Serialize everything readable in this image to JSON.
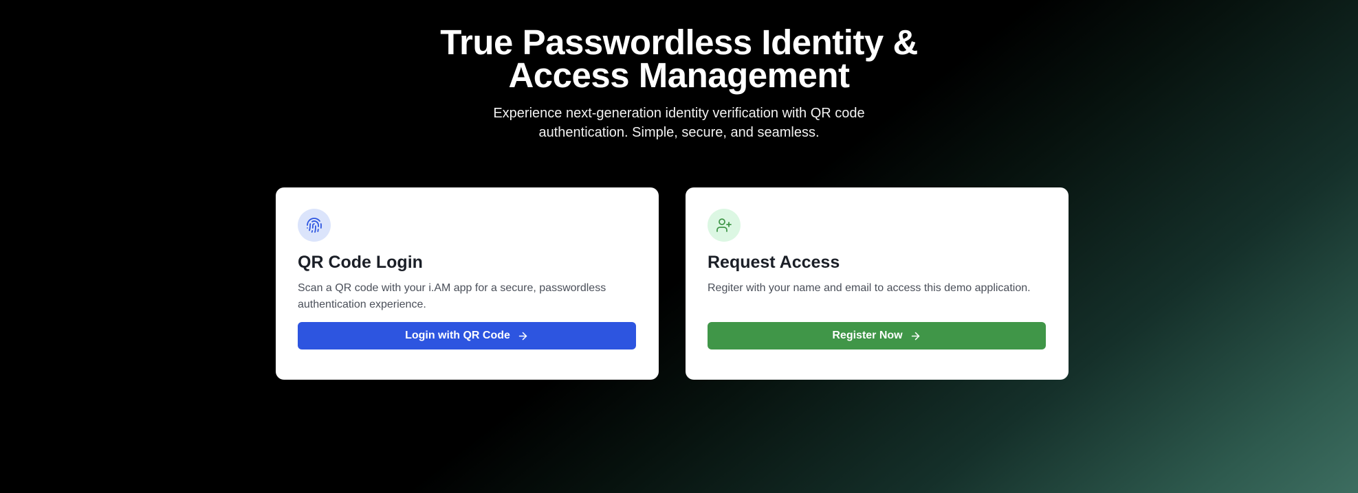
{
  "hero": {
    "title": "True Passwordless Identity & Access Management",
    "subtitle": "Experience next-generation identity verification with QR code authentication. Simple, secure, and seamless."
  },
  "cards": [
    {
      "icon": "fingerprint-icon",
      "title": "QR Code Login",
      "description": "Scan a QR code with your i.AM app for a secure, passwordless authentication experience.",
      "button_label": "Login with QR Code",
      "button_color": "#2d55e0",
      "icon_bg": "#dbe4fb"
    },
    {
      "icon": "user-plus-icon",
      "title": "Request Access",
      "description": "Regiter with your name and email to access this demo application.",
      "button_label": "Register Now",
      "button_color": "#409648",
      "icon_bg": "#dcf7e3"
    }
  ]
}
